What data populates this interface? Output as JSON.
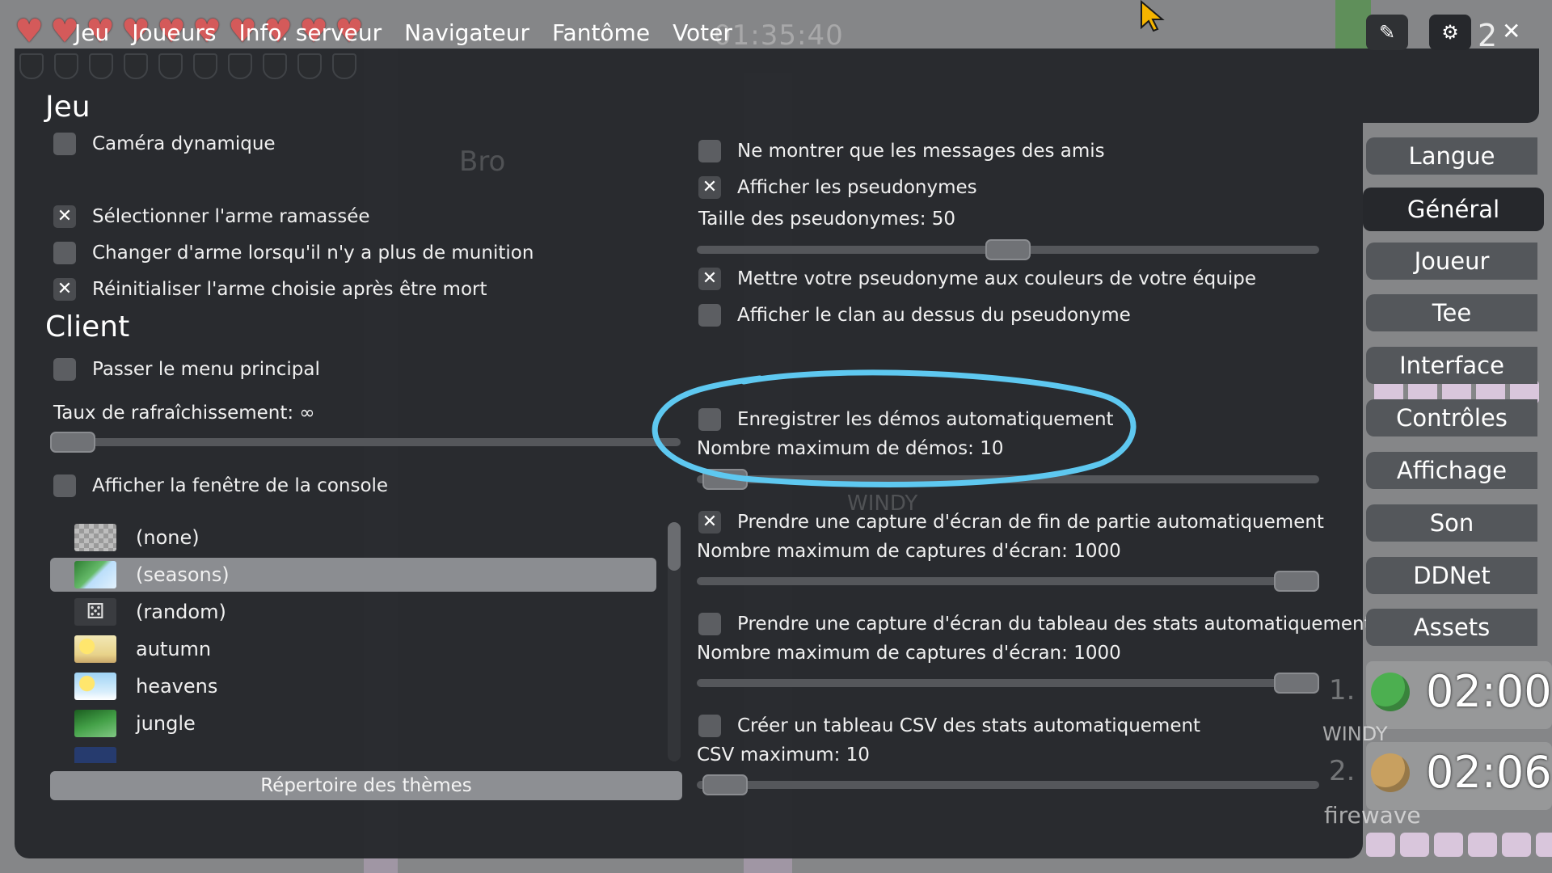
{
  "top_bar": {
    "tabs": [
      "Jeu",
      "Joueurs",
      "Info. serveur",
      "Navigateur",
      "Fantôme",
      "Voter"
    ],
    "timer": "01:35:40",
    "hearts": 10,
    "shields": 10,
    "edit_icon": "pencil-icon",
    "settings_icon": "gear-icon",
    "close_icon": "close-icon",
    "ghost_count": "2"
  },
  "game": {
    "title": "Jeu",
    "dynamic_camera": {
      "label": "Caméra dynamique",
      "checked": false
    },
    "select_picked_weapon": {
      "label": "Sélectionner l'arme ramassée",
      "checked": true
    },
    "switch_weapon_no_ammo": {
      "label": "Changer d'arme lorsqu'il n'y a plus de munition",
      "checked": false
    },
    "reset_weapon_on_death": {
      "label": "Réinitialiser l'arme choisie après être mort",
      "checked": true
    }
  },
  "client": {
    "title": "Client",
    "skip_main_menu": {
      "label": "Passer le menu principal",
      "checked": false
    },
    "refresh_rate_label": "Taux de rafraîchissement: ∞",
    "refresh_rate_level": 0,
    "show_console_window": {
      "label": "Afficher la fenêtre de la console",
      "checked": false
    },
    "themes": [
      {
        "name": "(none)",
        "selected": false
      },
      {
        "name": "(seasons)",
        "selected": true
      },
      {
        "name": "(random)",
        "selected": false
      },
      {
        "name": "autumn",
        "selected": false
      },
      {
        "name": "heavens",
        "selected": false
      },
      {
        "name": "jungle",
        "selected": false
      }
    ],
    "themes_dir_button": "Répertoire des thèmes"
  },
  "messages": {
    "friends_only": {
      "label": "Ne montrer que les messages des amis",
      "checked": false
    },
    "show_names": {
      "label": "Afficher les pseudonymes",
      "checked": true
    },
    "name_size_label": "Taille des pseudonymes: 50",
    "name_size_level": 0.5,
    "team_colored_names": {
      "label": "Mettre votre pseudonyme aux couleurs de votre équipe",
      "checked": true
    },
    "clan_above_name": {
      "label": "Afficher le clan au dessus du pseudonyme",
      "checked": false
    }
  },
  "auto": {
    "auto_demos": {
      "label": "Enregistrer les démos automatiquement",
      "checked": false
    },
    "max_demos_label": "Nombre maximum de démos: 10",
    "max_demos_level": 0.01,
    "auto_screenshot": {
      "label": "Prendre une capture d'écran de fin de partie automatiquement",
      "checked": true
    },
    "max_screenshots_label": "Nombre maximum de captures d'écran: 1000",
    "max_screenshots_level": 1.0,
    "auto_stats_screenshot": {
      "label": "Prendre une capture d'écran du tableau des stats automatiquement",
      "checked": false
    },
    "max_stats_screenshots_label": "Nombre maximum de captures d'écran: 1000",
    "max_stats_screenshots_level": 1.0,
    "auto_csv": {
      "label": "Créer un tableau CSV des stats automatiquement",
      "checked": false
    },
    "max_csv_label": "CSV maximum: 10",
    "max_csv_level": 0.01
  },
  "sidebar": {
    "items": [
      {
        "label": "Langue",
        "active": false
      },
      {
        "label": "Général",
        "active": true
      },
      {
        "label": "Joueur",
        "active": false
      },
      {
        "label": "Tee",
        "active": false
      },
      {
        "label": "Interface",
        "active": false
      },
      {
        "label": "Contrôles",
        "active": false
      },
      {
        "label": "Affichage",
        "active": false
      },
      {
        "label": "Son",
        "active": false
      },
      {
        "label": "DDNet",
        "active": false
      },
      {
        "label": "Assets",
        "active": false
      }
    ]
  },
  "race": [
    {
      "rank": "1.",
      "time": "02:00",
      "name": "WINDY",
      "tee_color": "#4caf50"
    },
    {
      "rank": "2.",
      "time": "02:06",
      "name": "firewave",
      "tee_color": "#c8a060"
    }
  ],
  "annotation_color": "#5ec8f0"
}
